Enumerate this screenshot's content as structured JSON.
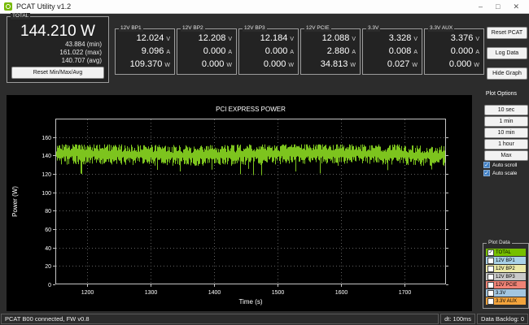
{
  "window": {
    "title": "PCAT Utility v1.2",
    "controls": {
      "minimize": "–",
      "maximize": "□",
      "close": "✕"
    }
  },
  "total_panel": {
    "label": "TOTAL",
    "value": "144.210 W",
    "min": "43.884 (min)",
    "max": "161.022 (max)",
    "avg": "140.707 (avg)",
    "reset_button": "Reset Min/Max/Avg"
  },
  "units": {
    "voltage": "V",
    "current": "A",
    "power": "W"
  },
  "rails": [
    {
      "label": "12V BP1",
      "voltage": "12.024",
      "current": "9.096",
      "power": "109.370"
    },
    {
      "label": "12V BP2",
      "voltage": "12.208",
      "current": "0.000",
      "power": "0.000"
    },
    {
      "label": "12V BP3",
      "voltage": "12.184",
      "current": "0.000",
      "power": "0.000"
    },
    {
      "label": "12V PCIE",
      "voltage": "12.088",
      "current": "2.880",
      "power": "34.813"
    },
    {
      "label": "3.3V",
      "voltage": "3.328",
      "current": "0.008",
      "power": "0.027"
    },
    {
      "label": "3.3V AUX",
      "voltage": "3.376",
      "current": "0.000",
      "power": "0.000"
    }
  ],
  "action_buttons": {
    "reset_pcat": "Reset PCAT",
    "log_data": "Log Data",
    "hide_graph": "Hide Graph"
  },
  "plot_options": {
    "label": "Plot Options",
    "buttons": [
      "10 sec",
      "1 min",
      "10 min",
      "1 hour",
      "Max"
    ],
    "auto_scroll": {
      "label": "Auto scroll",
      "checked": true
    },
    "auto_scale": {
      "label": "Auto scale",
      "checked": true
    }
  },
  "plot_data": {
    "label": "Plot Data",
    "items": [
      {
        "label": "TOTAL",
        "color": "#76c000",
        "checked": true
      },
      {
        "label": "12V BP1",
        "color": "#aad2e8",
        "checked": false
      },
      {
        "label": "12V BP2",
        "color": "#ece9a8",
        "checked": false
      },
      {
        "label": "12V BP3",
        "color": "#c9c9c9",
        "checked": false
      },
      {
        "label": "12V PCIE",
        "color": "#ef8376",
        "checked": false
      },
      {
        "label": "3.3V",
        "color": "#a3c6e0",
        "checked": false
      },
      {
        "label": "3.3V AUX",
        "color": "#f2a33c",
        "checked": false
      }
    ]
  },
  "status_bar": {
    "connection": "PCAT B00 connected, FW v0.8",
    "dt": "dt: 100ms",
    "backlog": "Data Backlog: 0"
  },
  "chart_data": {
    "type": "line",
    "title": "PCI EXPRESS POWER",
    "xlabel": "Time (s)",
    "ylabel": "Power (W)",
    "xlim": [
      1150,
      1765
    ],
    "ylim": [
      0,
      180
    ],
    "xticks": [
      1200,
      1300,
      1400,
      1500,
      1600,
      1700
    ],
    "yticks": [
      0,
      20,
      40,
      60,
      80,
      100,
      120,
      140,
      160
    ],
    "grid": true,
    "frame_color": "#c4c4c4",
    "grid_color": "#606060",
    "text_color": "#ffffff",
    "series": [
      {
        "name": "TOTAL",
        "color": "#7dc41e",
        "mean": 140.7,
        "band_high": 152,
        "band_low": 129,
        "dip_min": 112,
        "dip_chance": 0.035,
        "seed": 7
      }
    ]
  }
}
